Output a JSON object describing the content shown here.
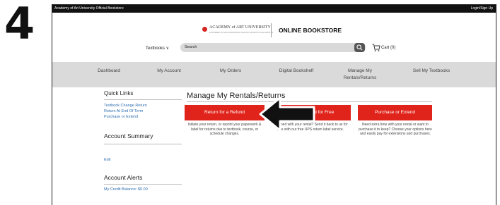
{
  "step_number": "4",
  "topbar": {
    "left": "Academy of Art University Official Bookstore",
    "right": "Login/Sign Up"
  },
  "brand": {
    "logo_text": "ACADEMY of ART UNIVERSITY",
    "logo_sub": "FOUNDED IN SAN FRANCISCO 1929 BY ARTISTS FOR ARTISTS",
    "store_name": "ONLINE BOOKSTORE"
  },
  "header": {
    "textbooks_menu": "Textbooks ∨",
    "search_placeholder": "Search",
    "cart_label": "Cart (0)"
  },
  "nav": [
    "Dashboard",
    "My Account",
    "My Orders",
    "Digital Bookshelf",
    "Manage My\nRentals/Returns",
    "Sell My Textbooks"
  ],
  "sidebar": {
    "quick_links_title": "Quick Links",
    "quick_links": [
      "Textbook Change Return",
      "Return At End Of Term",
      "Purchase or Extend"
    ],
    "account_summary_title": "Account Summary",
    "edit_label": "Edit",
    "account_alerts_title": "Account Alerts",
    "credit_balance": "My Credit Balance: $0.00"
  },
  "main": {
    "title": "Manage My Rentals/Returns",
    "actions": [
      {
        "label": "Return for a Refund",
        "description": "Initiate your return, or reprint your paperwork & label for returns due to textbook, course, or schedule changes."
      },
      {
        "label": "Return Rental for Free",
        "description": "Finished with your rental? Send it back to us for free with our free UPS return label service."
      },
      {
        "label": "Purchase or Extend",
        "description": "Need extra time with your rental or want to purchase it to keep? Choose your options here and easily pay for extensions and purchases."
      }
    ]
  },
  "colors": {
    "accent_red": "#e0231b",
    "link_blue": "#2f6fb0",
    "nav_gray": "#dadada"
  }
}
